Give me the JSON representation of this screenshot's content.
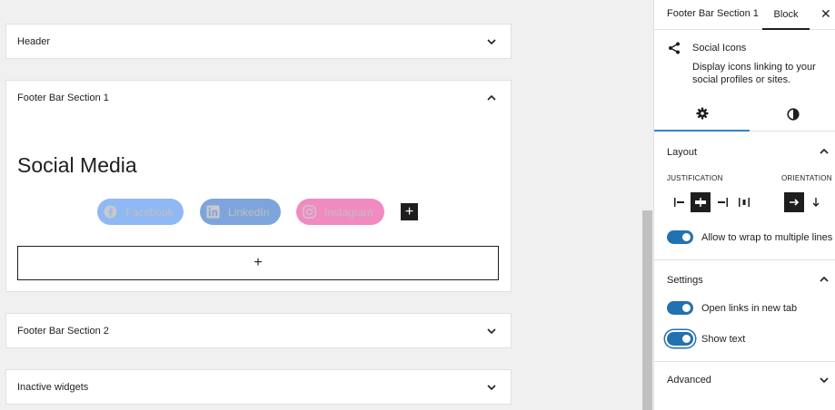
{
  "canvas": {
    "widgets": {
      "header": {
        "title": "Header"
      },
      "footer1": {
        "title": "Footer Bar Section 1",
        "heading": "Social Media",
        "social_links": [
          {
            "label": "Facebook",
            "icon": "facebook-icon",
            "color": "#8fb8f4"
          },
          {
            "label": "LinkedIn",
            "icon": "linkedin-icon",
            "color": "#7ea5db"
          },
          {
            "label": "Instagram",
            "icon": "instagram-icon",
            "color": "#f28ac2"
          }
        ],
        "add_icon_glyph": "+",
        "add_block_glyph": "+"
      },
      "footer2": {
        "title": "Footer Bar Section 2"
      },
      "inactive": {
        "title": "Inactive widgets"
      }
    }
  },
  "sidebar": {
    "tabs": {
      "section": "Footer Bar Section 1",
      "block": "Block",
      "close": "✕"
    },
    "block": {
      "icon": "share-icon",
      "name": "Social Icons",
      "description": "Display icons linking to your social profiles or sites."
    },
    "layout": {
      "title": "Layout",
      "justification_label": "JUSTIFICATION",
      "orientation_label": "ORIENTATION",
      "wrap_label": "Allow to wrap to multiple lines",
      "wrap_on": true
    },
    "settings": {
      "title": "Settings",
      "new_tab_label": "Open links in new tab",
      "new_tab_on": true,
      "show_text_label": "Show text",
      "show_text_on": true
    },
    "advanced": {
      "title": "Advanced"
    }
  },
  "colors": {
    "accent": "#2271b1",
    "dark": "#1e1e1e"
  }
}
